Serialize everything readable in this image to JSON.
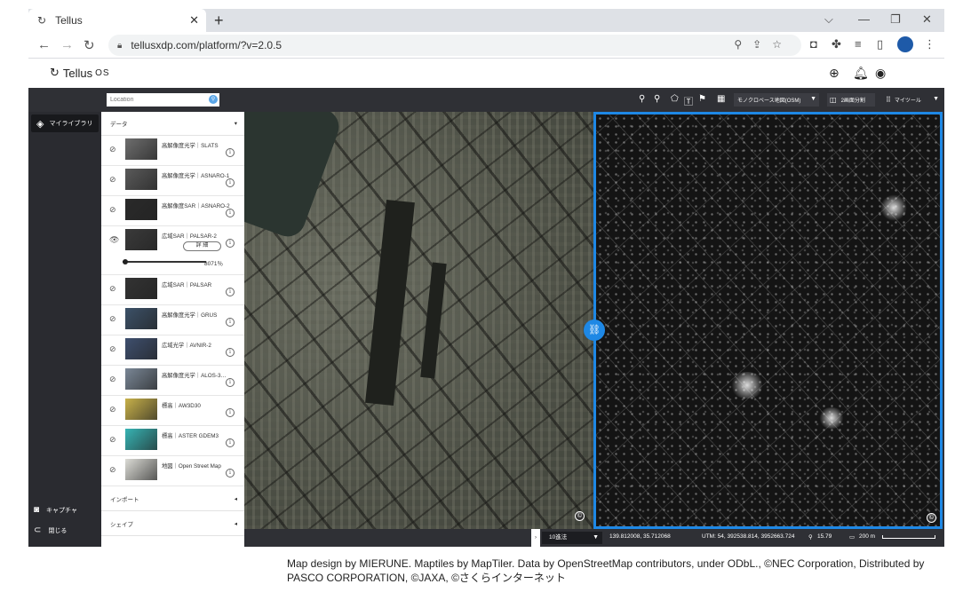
{
  "browser": {
    "tab_title": "Tellus",
    "url": "tellusxdp.com/platform/?v=2.0.5"
  },
  "header": {
    "brand": "Tellus",
    "brand_suffix": "OS"
  },
  "topbar": {
    "location_placeholder": "Location",
    "basemap": "モノクロベース地図(OSM)",
    "split_label": "2画面分割",
    "mytool_label": "マイツール"
  },
  "sidebar": {
    "library_label": "マイライブラリ",
    "capture_label": "キャプチャ",
    "close_label": "閉じる"
  },
  "panel": {
    "data_header": "データ",
    "layers": [
      {
        "name": "高解像度光学｜SLATS",
        "thumb_color": "#6e6e6e"
      },
      {
        "name": "高解像度光学｜ASNARO-1",
        "thumb_color": "#5a5a5a"
      },
      {
        "name": "高解像度SAR｜ASNARO-2",
        "thumb_color": "#2a2a2a"
      },
      {
        "name": "広域SAR｜PALSAR-2",
        "thumb_color": "#3a3a3a",
        "detail_label": "詳 細",
        "opacity": "8071％"
      },
      {
        "name": "広域SAR｜PALSAR",
        "thumb_color": "#333333"
      },
      {
        "name": "高解像度光学｜GRUS",
        "thumb_color": "#3c5168"
      },
      {
        "name": "広域光学｜AVNIR-2",
        "thumb_color": "#3e4f6e"
      },
      {
        "name": "高解像度光学｜ALOS-3…",
        "thumb_color": "#7a8796"
      },
      {
        "name": "標高｜AW3D30",
        "thumb_color": "#c8b14a"
      },
      {
        "name": "標高｜ASTER GDEM3",
        "thumb_color": "#37b4b4"
      },
      {
        "name": "地図｜Open Street Map",
        "thumb_color": "#dcdcd6"
      }
    ],
    "import_label": "インポート",
    "shape_label": "シェイプ"
  },
  "statusbar": {
    "coord_system": "10進法",
    "latlon": "139.812008, 35.712068",
    "utm": "UTM: 54, 392538.814, 3952663.724",
    "zoom": "15.79",
    "scale": "200 m"
  },
  "attribution": "Map design by MIERUNE. Maptiles by MapTiler. Data by OpenStreetMap contributors, under ODbL., ©NEC Corporation, Distributed by PASCO CORPORATION, ©JAXA, ©さくらインターネット",
  "colors": {
    "accent": "#1e88e5",
    "app_dark": "#2f3035"
  }
}
